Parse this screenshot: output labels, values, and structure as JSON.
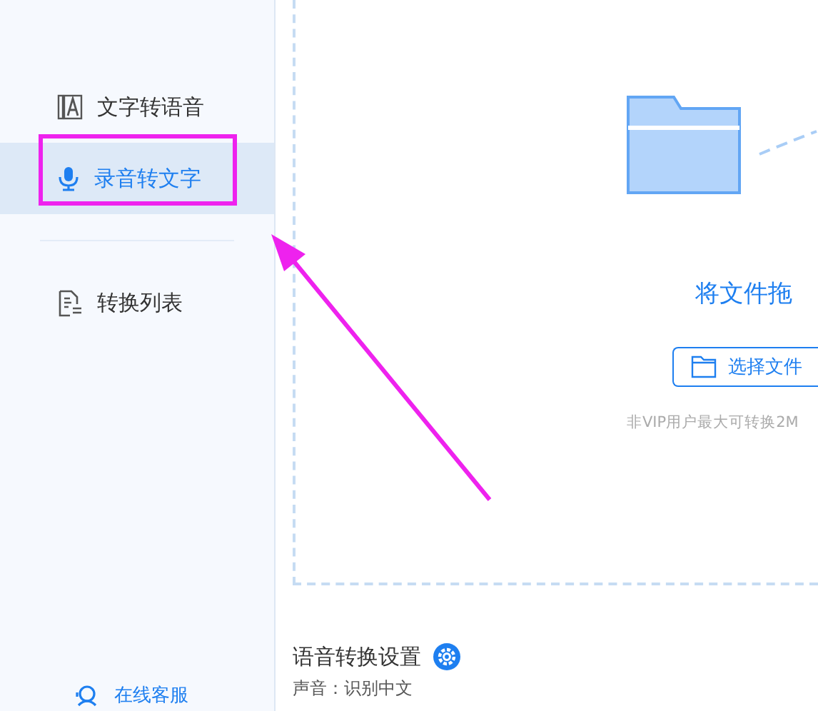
{
  "sidebar": {
    "items": [
      {
        "label": "文字转语音",
        "kind": "text-to-speech",
        "selected": false
      },
      {
        "label": "录音转文字",
        "kind": "speech-to-text",
        "selected": true
      },
      {
        "label": "转换列表",
        "kind": "list",
        "selected": false
      }
    ],
    "support": "在线客服"
  },
  "dropzone": {
    "prompt": "将文件拖",
    "button": "选择文件",
    "note": "非VIP用户最大可转换2M"
  },
  "settings": {
    "title": "语音转换设置",
    "row": "声音：识别中文"
  }
}
